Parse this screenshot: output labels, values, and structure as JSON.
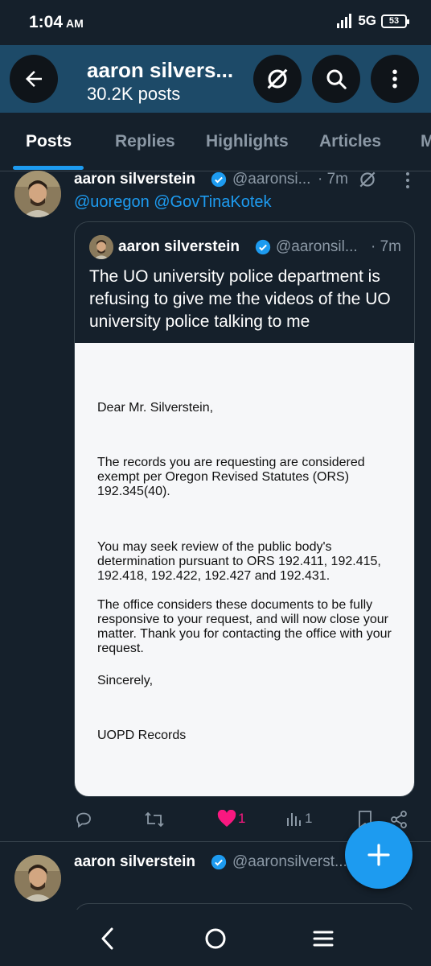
{
  "status": {
    "time": "1:04",
    "ampm": "AM",
    "network": "5G",
    "battery": "53"
  },
  "header": {
    "title": "aaron silvers...",
    "subtitle": "30.2K posts"
  },
  "tabs": [
    "Posts",
    "Replies",
    "Highlights",
    "Articles",
    "M"
  ],
  "post1": {
    "name": "aaron silverstein",
    "handle": "@aaronsi...",
    "time": "· 7m",
    "mentions": "@uoregon @GovTinaKotek",
    "quote": {
      "name": "aaron silverstein",
      "handle": "@aaronsil...",
      "time": "· 7m",
      "text": "The UO university police department is refusing to give me the videos of the UO university police talking to me",
      "doc": {
        "greeting": "Dear Mr. Silverstein,",
        "p1": "The records you are requesting are considered exempt per Oregon Revised Statutes (ORS) 192.345(40).",
        "p2": "You may seek review of the public body's determination pursuant to ORS 192.411, 192.415, 192.418, 192.422, 192.427 and 192.431.",
        "p3": "The office considers these documents to be fully responsive to your request, and will now close your matter. Thank you for contacting the office with your request.",
        "closing": "Sincerely,",
        "signature": "UOPD Records"
      }
    },
    "likes": "1",
    "views": "1"
  },
  "post2": {
    "name": "aaron silverstein",
    "handle": "@aaronsilverst..."
  },
  "colors": {
    "background": "#15202b",
    "header": "#1d4a68",
    "accent": "#1d9bf0",
    "like": "#f91880",
    "muted": "#8b98a5"
  },
  "icons": [
    "back-arrow-icon",
    "grok-icon",
    "search-icon",
    "more-vertical-icon",
    "verified-icon",
    "reply-icon",
    "repost-icon",
    "heart-icon",
    "views-icon",
    "bookmark-icon",
    "share-icon",
    "plus-icon",
    "nav-back-icon",
    "nav-home-icon",
    "nav-menu-icon"
  ]
}
